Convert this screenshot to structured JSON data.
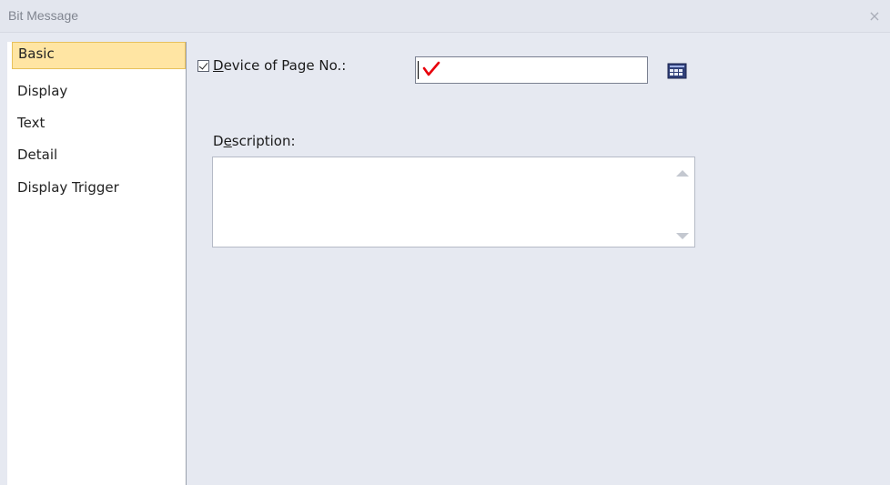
{
  "window": {
    "title": "Bit Message",
    "close_glyph": "×"
  },
  "sidebar": {
    "items": [
      {
        "label": "Basic",
        "selected": true
      },
      {
        "label": "Display",
        "selected": false
      },
      {
        "label": "Text",
        "selected": false
      },
      {
        "label": "Detail",
        "selected": false
      },
      {
        "label": "Display Trigger",
        "selected": false
      }
    ]
  },
  "basic": {
    "device_checkbox_checked": true,
    "device_label_first": "D",
    "device_label_rest": "evice of Page No.:",
    "device_value": "",
    "required_icon": "red-check-icon",
    "browse_icon": "device-browse-icon",
    "description_label_first": "D",
    "description_label_mnemonic": "e",
    "description_label_rest": "scription:",
    "description_value": ""
  },
  "colors": {
    "selected_item_bg": "#ffe5a3",
    "selected_item_border": "#e8c15c",
    "required_mark": "#e8000b",
    "panel_bg": "#e6e9f1"
  }
}
